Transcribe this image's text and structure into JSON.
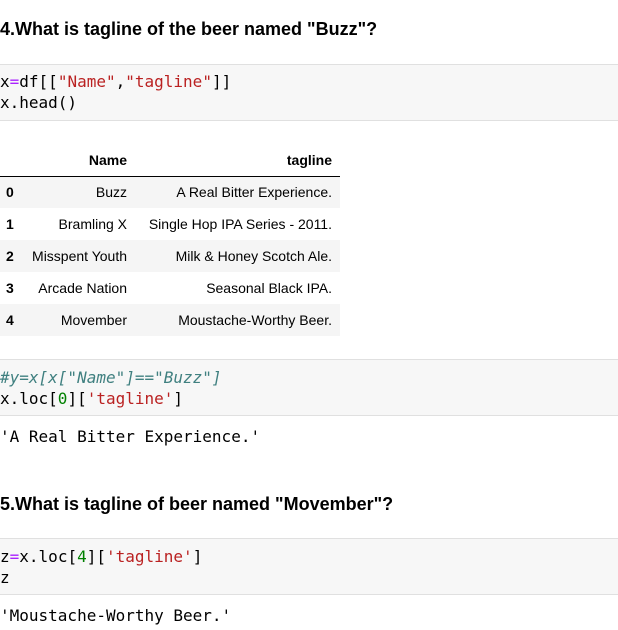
{
  "q4": {
    "heading": "4.What is tagline of the beer named \"Buzz\"?"
  },
  "code1": {
    "line1": {
      "var": "x",
      "op": "=",
      "rest1": "df[[",
      "s1": "\"Name\"",
      "comma": ",",
      "s2": "\"tagline\"",
      "rest2": "]]"
    },
    "line2": "x.head()"
  },
  "table": {
    "columns": [
      "Name",
      "tagline"
    ],
    "rows": [
      {
        "index": "0",
        "name": "Buzz",
        "tagline": "A Real Bitter Experience."
      },
      {
        "index": "1",
        "name": "Bramling X",
        "tagline": "Single Hop IPA Series - 2011."
      },
      {
        "index": "2",
        "name": "Misspent Youth",
        "tagline": "Milk & Honey Scotch Ale."
      },
      {
        "index": "3",
        "name": "Arcade Nation",
        "tagline": "Seasonal Black IPA."
      },
      {
        "index": "4",
        "name": "Movember",
        "tagline": "Moustache-Worthy Beer."
      }
    ]
  },
  "code2": {
    "comment": "#y=x[x[\"Name\"]==\"Buzz\"]",
    "line2": {
      "a": "x.loc[",
      "num": "0",
      "b": "][",
      "s": "'tagline'",
      "c": "]"
    }
  },
  "out1": "'A Real Bitter Experience.'",
  "q5": {
    "heading": "5.What is tagline of beer named \"Movember\"?"
  },
  "code3": {
    "line1": {
      "var": "z",
      "op": "=",
      "a": "x.loc[",
      "num": "4",
      "b": "][",
      "s": "'tagline'",
      "c": "]"
    },
    "line2": "z"
  },
  "out2": "'Moustache-Worthy Beer.'"
}
